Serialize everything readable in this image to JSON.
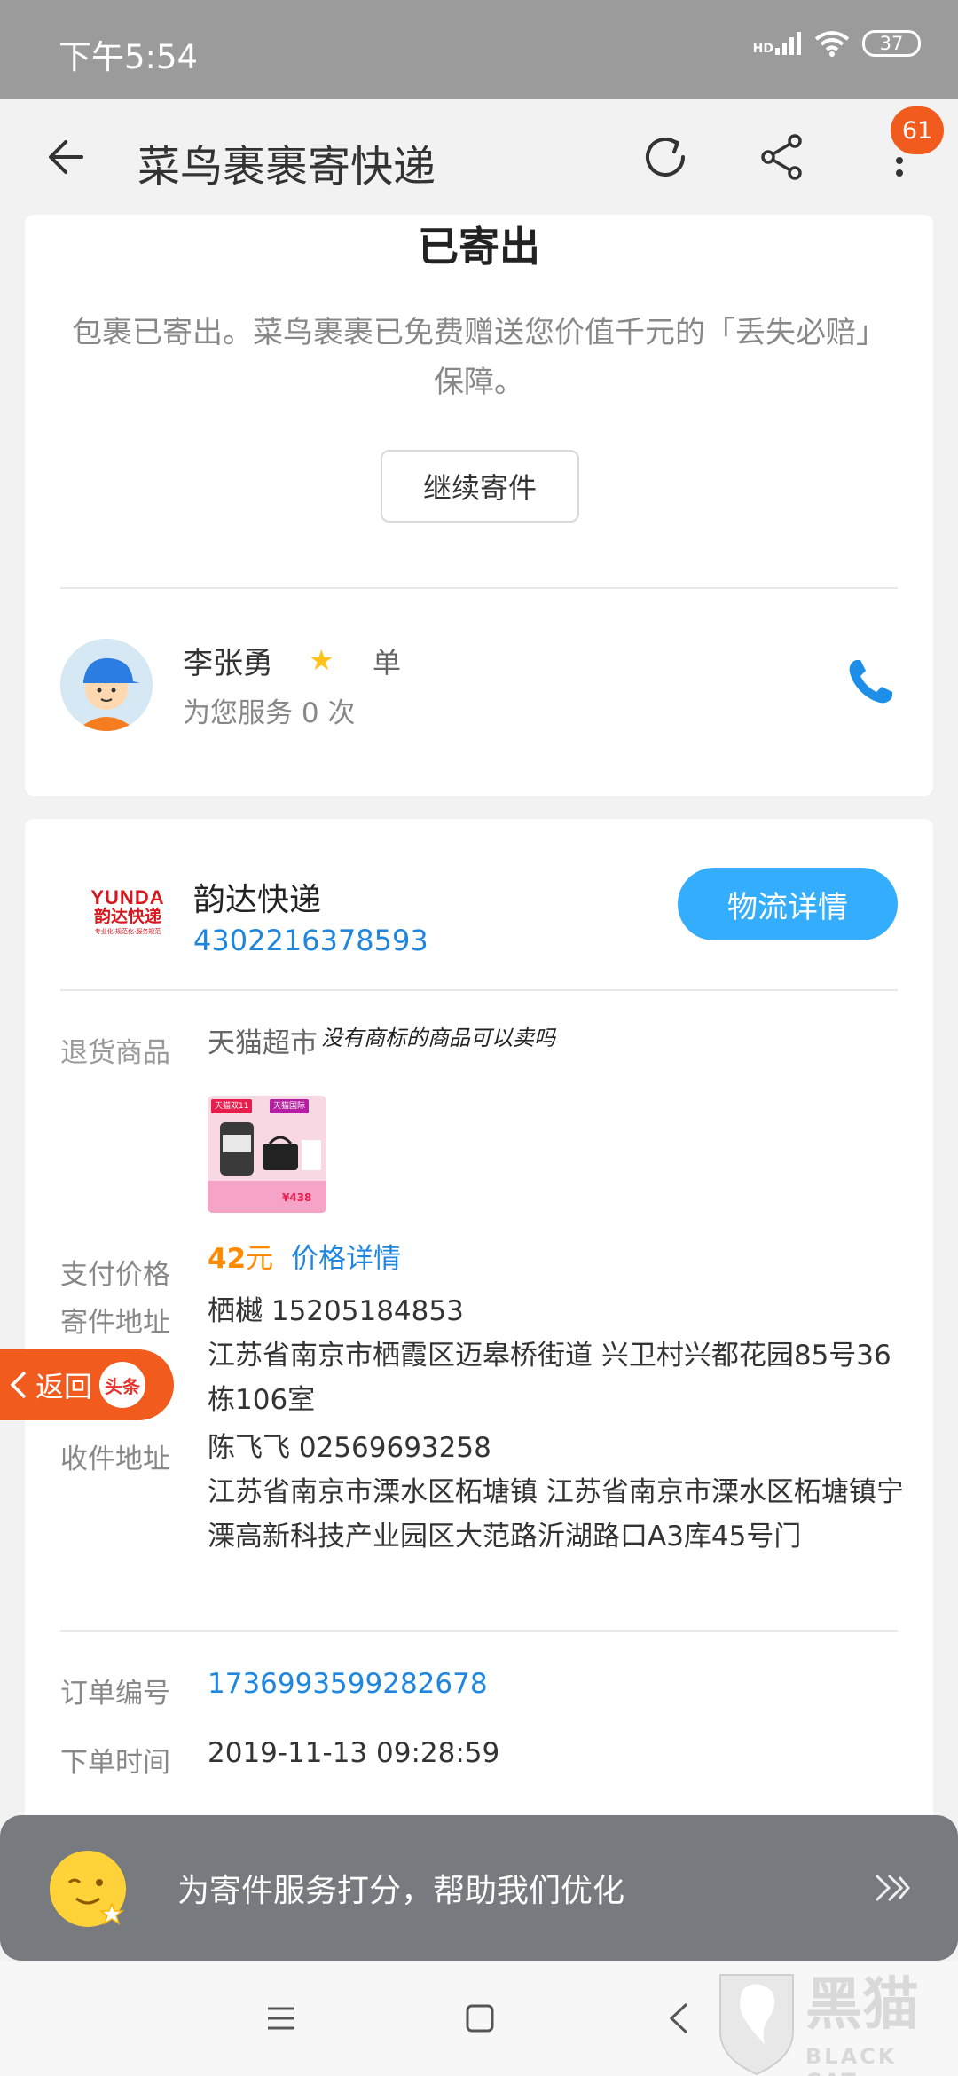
{
  "status_bar": {
    "time": "下午5:54",
    "network": "HD",
    "battery": "37"
  },
  "header": {
    "title": "菜鸟裹裹寄快递",
    "notification_count": "61"
  },
  "status": {
    "title": "已寄出",
    "description": "包裹已寄出。菜鸟裹裹已免费赠送您价值千元的「丢失必赔」保障。",
    "continue_button": "继续寄件"
  },
  "courier": {
    "name": "李张勇",
    "unit": "单",
    "served": "为您服务 0 次"
  },
  "shipment": {
    "logo_text": "YUNDA",
    "logo_sub": "韵达快递",
    "logo_tag": "专业化·规范化·服务规范",
    "company": "韵达快递",
    "waybill": "4302216378593",
    "logistics_button": "物流详情"
  },
  "details": {
    "return_label": "退货商品",
    "return_value": "天猫超市",
    "handwriting": "没有商标的商品可以卖吗",
    "thumb_tag1": "天猫双11",
    "thumb_tag2": "天猫国际",
    "thumb_price": "¥438",
    "pay_label": "支付价格",
    "pay_amount": "42",
    "pay_unit": "元",
    "pay_link": "价格详情",
    "send_label": "寄件地址",
    "send_contact": "栖樾 15205184853",
    "send_address": "江苏省南京市栖霞区迈皋桥街道 兴卫村兴都花园85号36栋106室",
    "recv_label": "收件地址",
    "recv_contact": "陈飞飞 02569693258",
    "recv_address": "江苏省南京市溧水区柘塘镇 江苏省南京市溧水区柘塘镇宁溧高新科技产业园区大范路沂湖路口A3库45号门",
    "order_label": "订单编号",
    "order_value": "1736993599282678",
    "time_label": "下单时间",
    "time_value": "2019-11-13 09:28:59"
  },
  "floating_back": {
    "label": "返回",
    "app": "头条"
  },
  "rating_banner": {
    "text": "为寄件服务打分，帮助我们优化"
  },
  "watermark": {
    "cn": "黑猫",
    "en": "BLACK CAT"
  },
  "colors": {
    "accent_blue": "#34aefc",
    "link_blue": "#1f86e0",
    "orange": "#ff8a00",
    "badge": "#f25b1e"
  }
}
